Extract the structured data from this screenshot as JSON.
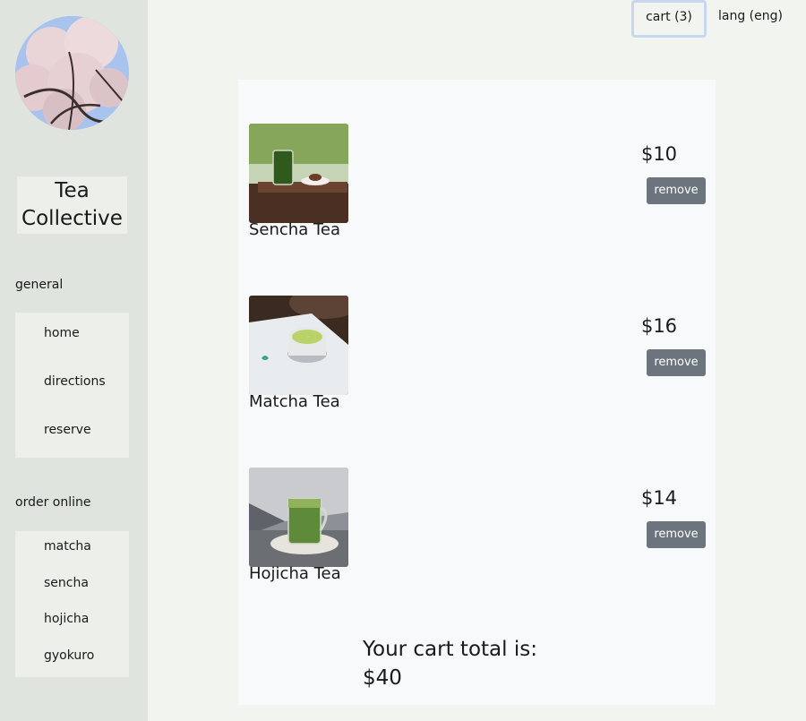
{
  "sidebar": {
    "brand_line1": "Tea",
    "brand_line2": "Collective",
    "general_label": "general",
    "general_items": [
      {
        "label": "home"
      },
      {
        "label": "directions"
      },
      {
        "label": "reserve"
      }
    ],
    "order_label": "order online",
    "order_items": [
      {
        "label": "matcha"
      },
      {
        "label": "sencha"
      },
      {
        "label": "hojicha"
      },
      {
        "label": "gyokuro"
      }
    ]
  },
  "header": {
    "cart_label": "cart (3)",
    "lang_label": "lang (eng)"
  },
  "cart": {
    "items": [
      {
        "name": "Sencha Tea",
        "price": "$10",
        "remove_label": "remove"
      },
      {
        "name": "Matcha Tea",
        "price": "$16",
        "remove_label": "remove"
      },
      {
        "name": "Hojicha Tea",
        "price": "$14",
        "remove_label": "remove"
      }
    ],
    "total_label": "Your cart total is:",
    "total_value": "$40"
  },
  "colors": {
    "sidebar_bg": "#dfe4de",
    "page_bg": "#f2f4f0",
    "panel_bg": "#f8f9fa",
    "button_bg": "#6c757d",
    "cart_border": "#c6d7ef"
  }
}
